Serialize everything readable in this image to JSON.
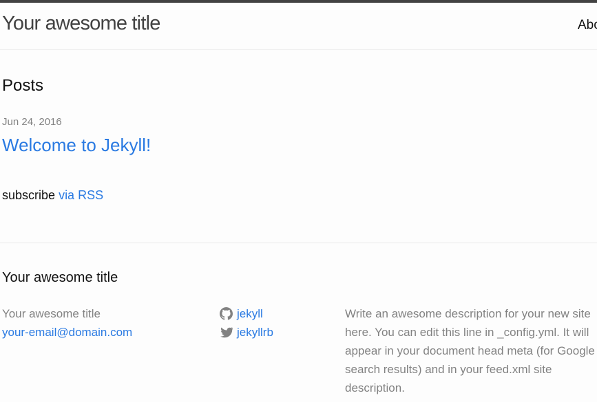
{
  "header": {
    "site_title": "Your awesome title",
    "nav_about": "About"
  },
  "main": {
    "heading": "Posts",
    "posts": [
      {
        "date": "Jun 24, 2016",
        "title": "Welcome to Jekyll!"
      }
    ],
    "rss": {
      "prefix": "subscribe",
      "link_label": "via RSS"
    }
  },
  "footer": {
    "heading": "Your awesome title",
    "name": "Your awesome title",
    "email": "your-email@domain.com",
    "social": [
      {
        "icon": "github-icon",
        "label": "jekyll"
      },
      {
        "icon": "twitter-icon",
        "label": "jekyllrb"
      }
    ],
    "description": "Write an awesome description for your new site here. You can edit this line in _config.yml. It will appear in your document head meta (for Google search results) and in your feed.xml site description."
  },
  "colors": {
    "link": "#2a7ae2",
    "muted": "#828282",
    "header_border": "#424242"
  }
}
